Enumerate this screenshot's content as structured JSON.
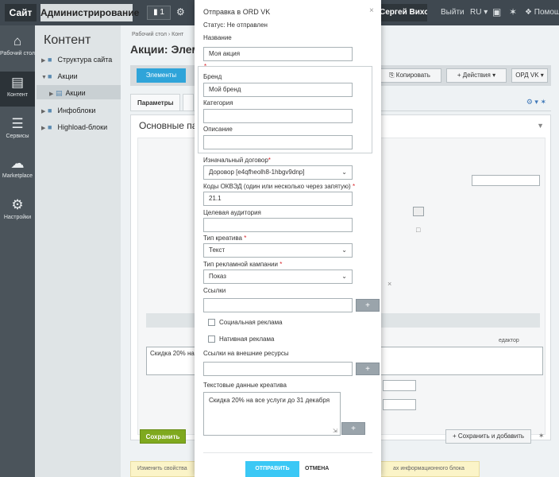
{
  "topbar": {
    "site": "Сайт",
    "admin": "Администрирование",
    "badge": "1",
    "user": "Сергей Вихорев",
    "logout": "Выйти",
    "lang": "RU",
    "help": "Помощь"
  },
  "leftmenu": {
    "items": [
      {
        "label": "Рабочий стол",
        "icon": "home-icon"
      },
      {
        "label": "Контент",
        "icon": "document-icon"
      },
      {
        "label": "Сервисы",
        "icon": "layers-icon"
      },
      {
        "label": "Marketplace",
        "icon": "cloud-icon"
      },
      {
        "label": "Настройки",
        "icon": "gear-icon"
      }
    ]
  },
  "tree": {
    "title": "Контент",
    "items": [
      "Структура сайта",
      "Акции",
      "Акции",
      "Инфоблоки",
      "Highload-блоки"
    ]
  },
  "main": {
    "breadcrumb": "Рабочий стол  ›  Конт",
    "title": "Акции: Элем",
    "toolbar": {
      "elements": "Элементы",
      "copy": "Копировать",
      "actions": "Действия",
      "ordvk": "ОРД VK"
    },
    "tab": "Параметры",
    "panel_title": "Основные па",
    "textarea_text": "Скидка 20% на",
    "editor_label": "едактор",
    "save": "Сохранить",
    "save_add": "Сохранить и добавить",
    "bottom_note": "Изменить свойства",
    "bottom_note_right": "ах информационного блока"
  },
  "modal": {
    "title": "Отправка в ORD VK",
    "status": "Статус: Не отправлен",
    "name_label": "Название",
    "name_value": "Моя акция",
    "brand_label": "Бренд",
    "brand_value": "Мой бренд",
    "category_label": "Категория",
    "category_value": "",
    "description_label": "Описание",
    "description_value": "",
    "contract_label": "Изначальный договор",
    "contract_value": "Доровор [e4qfheolh8-1hbgv9dnp]",
    "okved_label": "Коды ОКВЭД (один или несколько через запятую)",
    "okved_value": "21.1",
    "audience_label": "Целевая аудитория",
    "audience_value": "",
    "creative_type_label": "Тип креатива",
    "creative_type_value": "Текст",
    "campaign_type_label": "Тип рекламной кампании",
    "campaign_type_value": "Показ",
    "links_label": "Ссылки",
    "links_value": "",
    "social_label": "Социальная реклама",
    "native_label": "Нативная реклама",
    "ext_links_label": "Ссылки на внешние ресурсы",
    "ext_links_value": "",
    "text_data_label": "Текстовые данные креатива",
    "text_data_value": "Скидка 20% на все услуги до 31 декабря",
    "plus": "+",
    "send": "ОТПРАВИТЬ",
    "cancel": "ОТМЕНА",
    "close": "×"
  }
}
